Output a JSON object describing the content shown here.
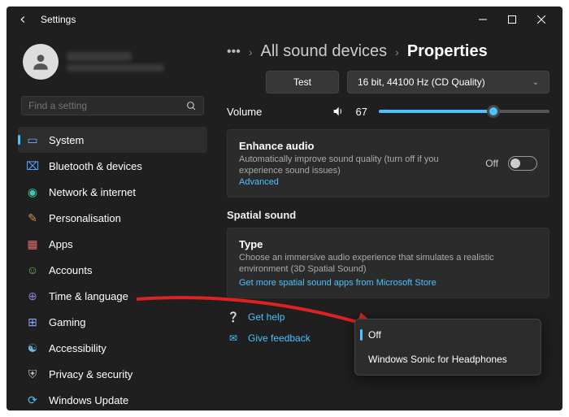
{
  "window": {
    "title": "Settings"
  },
  "search": {
    "placeholder": "Find a setting"
  },
  "sidebar": {
    "items": [
      {
        "label": "System"
      },
      {
        "label": "Bluetooth & devices"
      },
      {
        "label": "Network & internet"
      },
      {
        "label": "Personalisation"
      },
      {
        "label": "Apps"
      },
      {
        "label": "Accounts"
      },
      {
        "label": "Time & language"
      },
      {
        "label": "Gaming"
      },
      {
        "label": "Accessibility"
      },
      {
        "label": "Privacy & security"
      },
      {
        "label": "Windows Update"
      }
    ]
  },
  "breadcrumb": {
    "parent": "All sound devices",
    "current": "Properties"
  },
  "controls": {
    "test": "Test",
    "format": "16 bit, 44100 Hz (CD Quality)",
    "volume_label": "Volume",
    "volume_value": "67"
  },
  "enhance": {
    "title": "Enhance audio",
    "sub": "Automatically improve sound quality (turn off if you experience sound issues)",
    "advanced": "Advanced",
    "toggle_label": "Off"
  },
  "spatial": {
    "section": "Spatial sound",
    "title": "Type",
    "sub": "Choose an immersive audio experience that simulates a realistic environment (3D Spatial Sound)",
    "store": "Get more spatial sound apps from Microsoft Store"
  },
  "dropdown": {
    "options": [
      {
        "label": "Off"
      },
      {
        "label": "Windows Sonic for Headphones"
      }
    ]
  },
  "help": {
    "get": "Get help",
    "feedback": "Give feedback"
  }
}
